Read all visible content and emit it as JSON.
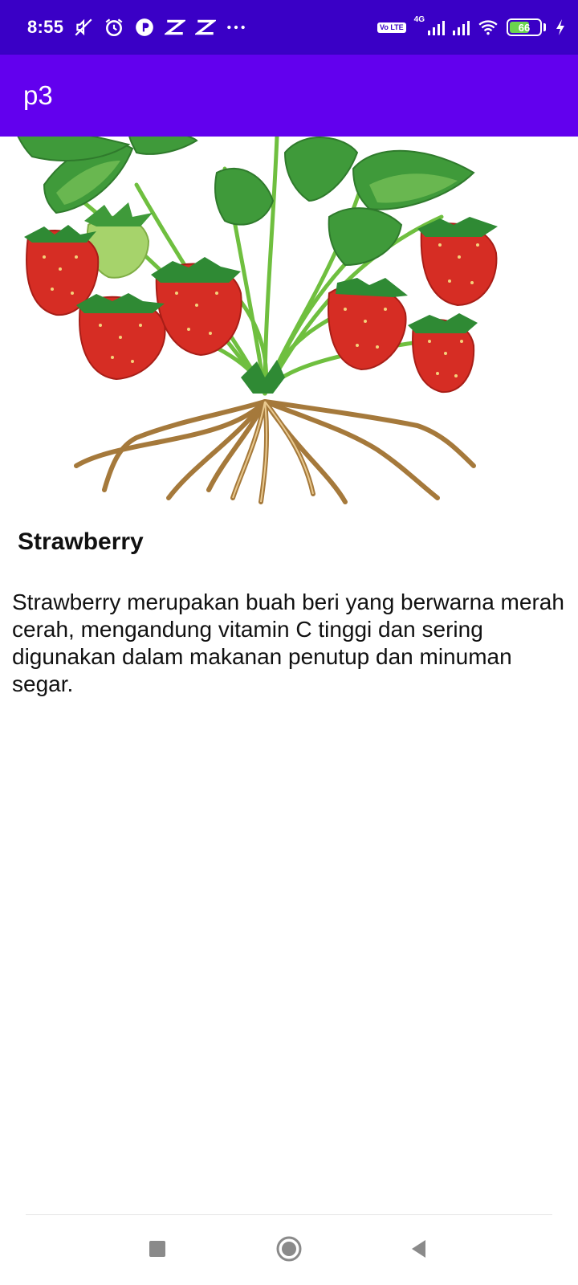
{
  "status_bar": {
    "time": "8:55",
    "network_badge": "Vo LTE",
    "network_type": "4G",
    "battery_level": 66,
    "battery_label": "66",
    "battery_color": "#6bd44e",
    "icons": [
      "mute-icon",
      "alarm-icon",
      "app-icon",
      "capcut-icon",
      "capcut-icon",
      "more-icon",
      "volte-icon",
      "signal-icon",
      "signal-icon",
      "wifi-icon",
      "battery-icon",
      "charging-icon"
    ],
    "background_color": "#3a00c6"
  },
  "app_bar": {
    "title": "p3",
    "background_color": "#6200ee"
  },
  "content": {
    "image_alt_name": "strawberry-plant-illustration",
    "title": "Strawberry",
    "description": "Strawberry merupakan buah beri yang berwarna merah cerah, mengandung vitamin C tinggi dan sering digunakan dalam makanan penutup dan minuman segar."
  },
  "nav_bar": {
    "buttons": [
      "recents-button",
      "home-button",
      "back-button"
    ]
  }
}
